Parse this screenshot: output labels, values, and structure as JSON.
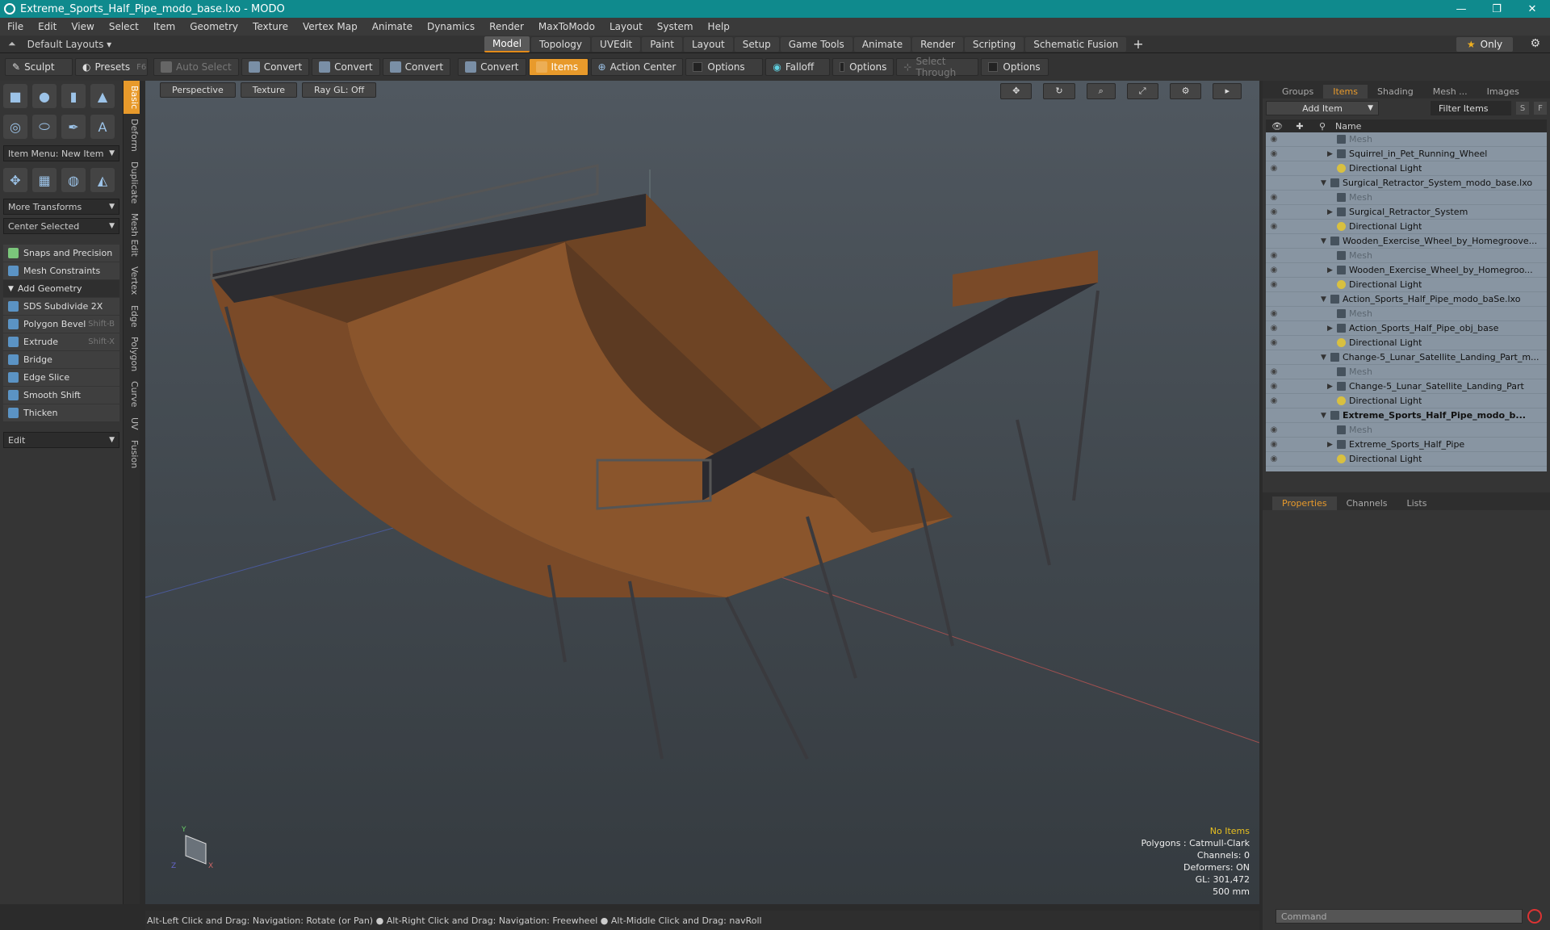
{
  "window": {
    "title": "Extreme_Sports_Half_Pipe_modo_base.lxo - MODO",
    "controls": [
      "—",
      "❐",
      "✕"
    ]
  },
  "menu": [
    "File",
    "Edit",
    "View",
    "Select",
    "Item",
    "Geometry",
    "Texture",
    "Vertex Map",
    "Animate",
    "Dynamics",
    "Render",
    "MaxToModo",
    "Layout",
    "System",
    "Help"
  ],
  "layout": {
    "default_layouts": "Default Layouts",
    "tabs": [
      "Model",
      "Topology",
      "UVEdit",
      "Paint",
      "Layout",
      "Setup",
      "Game Tools",
      "Animate",
      "Render",
      "Scripting",
      "Schematic Fusion"
    ],
    "active_tab": "Model",
    "only_label": "Only"
  },
  "toolbar": {
    "sculpt": "Sculpt",
    "presets": "Presets",
    "presets_key": "F6",
    "auto_select": "Auto Select",
    "convert1": "Convert",
    "convert2": "Convert",
    "convert3": "Convert",
    "convert4": "Convert",
    "items": "Items",
    "action_center": "Action Center",
    "options1": "Options",
    "falloff": "Falloff",
    "options2": "Options",
    "select_through": "Select Through",
    "options3": "Options"
  },
  "left_panel": {
    "item_menu": "Item Menu: New Item",
    "more_transforms": "More Transforms",
    "center_selected": "Center Selected",
    "snaps": "Snaps and Precision",
    "mesh_constraints": "Mesh Constraints",
    "add_geometry": "Add Geometry",
    "tools": [
      {
        "label": "SDS Subdivide 2X",
        "shortcut": ""
      },
      {
        "label": "Polygon Bevel",
        "shortcut": "Shift-B"
      },
      {
        "label": "Extrude",
        "shortcut": "Shift-X"
      },
      {
        "label": "Bridge",
        "shortcut": ""
      },
      {
        "label": "Edge Slice",
        "shortcut": ""
      },
      {
        "label": "Smooth Shift",
        "shortcut": ""
      },
      {
        "label": "Thicken",
        "shortcut": ""
      }
    ],
    "edit": "Edit",
    "vertical_tabs": [
      "Basic",
      "Deform",
      "Duplicate",
      "Mesh Edit",
      "Vertex",
      "Edge",
      "Polygon",
      "Curve",
      "UV",
      "Fusion"
    ]
  },
  "viewport": {
    "perspective": "Perspective",
    "texture": "Texture",
    "raygl": "Ray GL: Off",
    "info": {
      "no_items": "No Items",
      "polygons": "Polygons : Catmull-Clark",
      "channels": "Channels: 0",
      "deformers": "Deformers: ON",
      "gl": "GL: 301,472",
      "scale": "500 mm"
    }
  },
  "status": "Alt-Left Click and Drag: Navigation: Rotate (or Pan) ● Alt-Right Click and Drag: Navigation: Freewheel ● Alt-Middle Click and Drag: navRoll",
  "right_panel": {
    "tabs": [
      "Groups",
      "Items",
      "Shading",
      "Mesh ...",
      "Images"
    ],
    "active_tab": "Items",
    "add_item": "Add Item",
    "filter": "Filter Items",
    "s_btn": "S",
    "f_btn": "F",
    "col_name": "Name",
    "items": [
      {
        "label": "Mesh",
        "type": "mesh",
        "indent": 2
      },
      {
        "label": "Squirrel_in_Pet_Running_Wheel",
        "type": "item",
        "indent": 2
      },
      {
        "label": "Directional Light",
        "type": "light",
        "indent": 2
      },
      {
        "label": "Surgical_Retractor_System_modo_base.lxo",
        "type": "scene",
        "indent": 1
      },
      {
        "label": "Mesh",
        "type": "mesh",
        "indent": 2
      },
      {
        "label": "Surgical_Retractor_System",
        "type": "item",
        "indent": 2
      },
      {
        "label": "Directional Light",
        "type": "light",
        "indent": 2
      },
      {
        "label": "Wooden_Exercise_Wheel_by_Homegroove...",
        "type": "scene",
        "indent": 1
      },
      {
        "label": "Mesh",
        "type": "mesh",
        "indent": 2
      },
      {
        "label": "Wooden_Exercise_Wheel_by_Homegroo...",
        "type": "item",
        "indent": 2
      },
      {
        "label": "Directional Light",
        "type": "light",
        "indent": 2
      },
      {
        "label": "Action_Sports_Half_Pipe_modo_baSe.lxo",
        "type": "scene",
        "indent": 1
      },
      {
        "label": "Mesh",
        "type": "mesh",
        "indent": 2
      },
      {
        "label": "Action_Sports_Half_Pipe_obj_base",
        "type": "item",
        "indent": 2
      },
      {
        "label": "Directional Light",
        "type": "light",
        "indent": 2
      },
      {
        "label": "Change-5_Lunar_Satellite_Landing_Part_m...",
        "type": "scene",
        "indent": 1
      },
      {
        "label": "Mesh",
        "type": "mesh",
        "indent": 2
      },
      {
        "label": "Change-5_Lunar_Satellite_Landing_Part",
        "type": "item",
        "indent": 2
      },
      {
        "label": "Directional Light",
        "type": "light",
        "indent": 2
      },
      {
        "label": "Extreme_Sports_Half_Pipe_modo_b...",
        "type": "scene-bold",
        "indent": 1
      },
      {
        "label": "Mesh",
        "type": "mesh",
        "indent": 2
      },
      {
        "label": "Extreme_Sports_Half_Pipe",
        "type": "item",
        "indent": 2
      },
      {
        "label": "Directional Light",
        "type": "light",
        "indent": 2
      }
    ],
    "prop_tabs": [
      "Properties",
      "Channels",
      "Lists"
    ],
    "active_prop_tab": "Properties",
    "command_placeholder": "Command"
  }
}
